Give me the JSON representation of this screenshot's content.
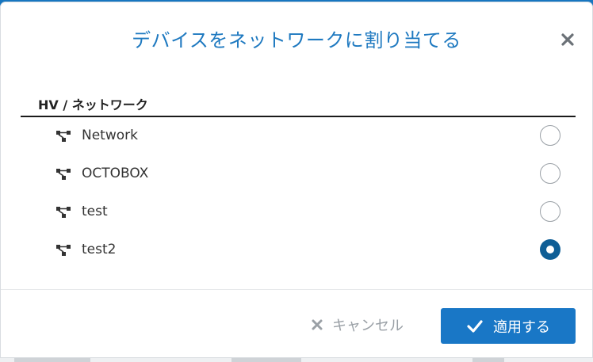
{
  "dialog": {
    "title": "デバイスをネットワークに割り当てる",
    "close_icon": "close-icon"
  },
  "list": {
    "header": "HV / ネットワーク",
    "items": [
      {
        "label": "Network",
        "icon": "network-topology-icon",
        "selected": false
      },
      {
        "label": "OCTOBOX",
        "icon": "network-topology-icon",
        "selected": false
      },
      {
        "label": "test",
        "icon": "network-topology-icon",
        "selected": false
      },
      {
        "label": "test2",
        "icon": "network-topology-icon",
        "selected": true
      }
    ]
  },
  "footer": {
    "cancel_label": "キャンセル",
    "cancel_icon": "x-icon",
    "apply_label": "適用する",
    "apply_icon": "check-icon"
  },
  "colors": {
    "title": "#1e79c0",
    "primary_button": "#1977c6",
    "radio_selected": "#0e5e96",
    "cancel_text": "#9aa0a6",
    "top_bar": "#1776c0"
  }
}
